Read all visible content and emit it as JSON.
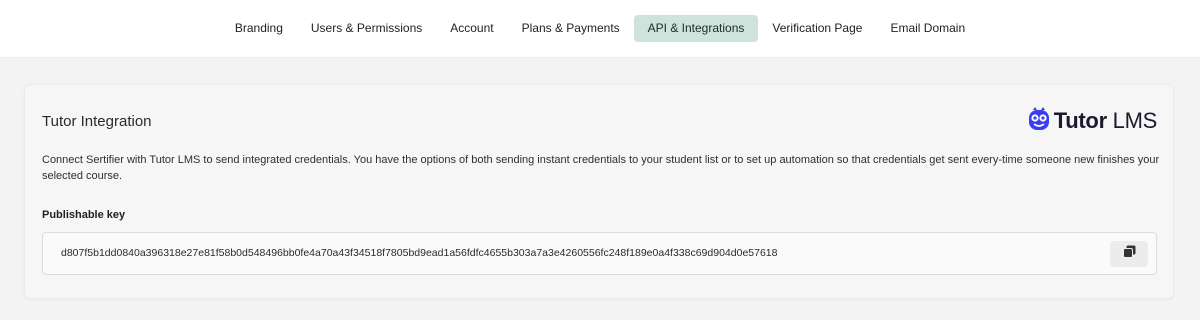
{
  "nav": {
    "tabs": [
      {
        "label": "Branding",
        "active": false
      },
      {
        "label": "Users & Permissions",
        "active": false
      },
      {
        "label": "Account",
        "active": false
      },
      {
        "label": "Plans & Payments",
        "active": false
      },
      {
        "label": "API & Integrations",
        "active": true
      },
      {
        "label": "Verification Page",
        "active": false
      },
      {
        "label": "Email Domain",
        "active": false
      }
    ]
  },
  "integration": {
    "title": "Tutor Integration",
    "brand_bold": "Tutor",
    "brand_light": " LMS",
    "brand_icon": "tutor-owl-icon",
    "description": "Connect Sertifier with Tutor LMS to send integrated credentials. You have the options of both sending instant credentials to your student list or to set up automation so that credentials get sent every-time someone new finishes your selected course.",
    "key_label": "Publishable key",
    "key_value": "d807f5b1dd0840a396318e27e81f58b0d548496bb0fe4a70a43f34518f7805bd9ead1a56fdfc4655b303a7a3e4260556fc248f189e0a4f338c69d904d0e57618",
    "copy_icon": "copy-icon"
  },
  "colors": {
    "active_tab_bg": "#cfe3dd",
    "brand_icon": "#3b3df0",
    "page_bg": "#f3f3f3"
  }
}
